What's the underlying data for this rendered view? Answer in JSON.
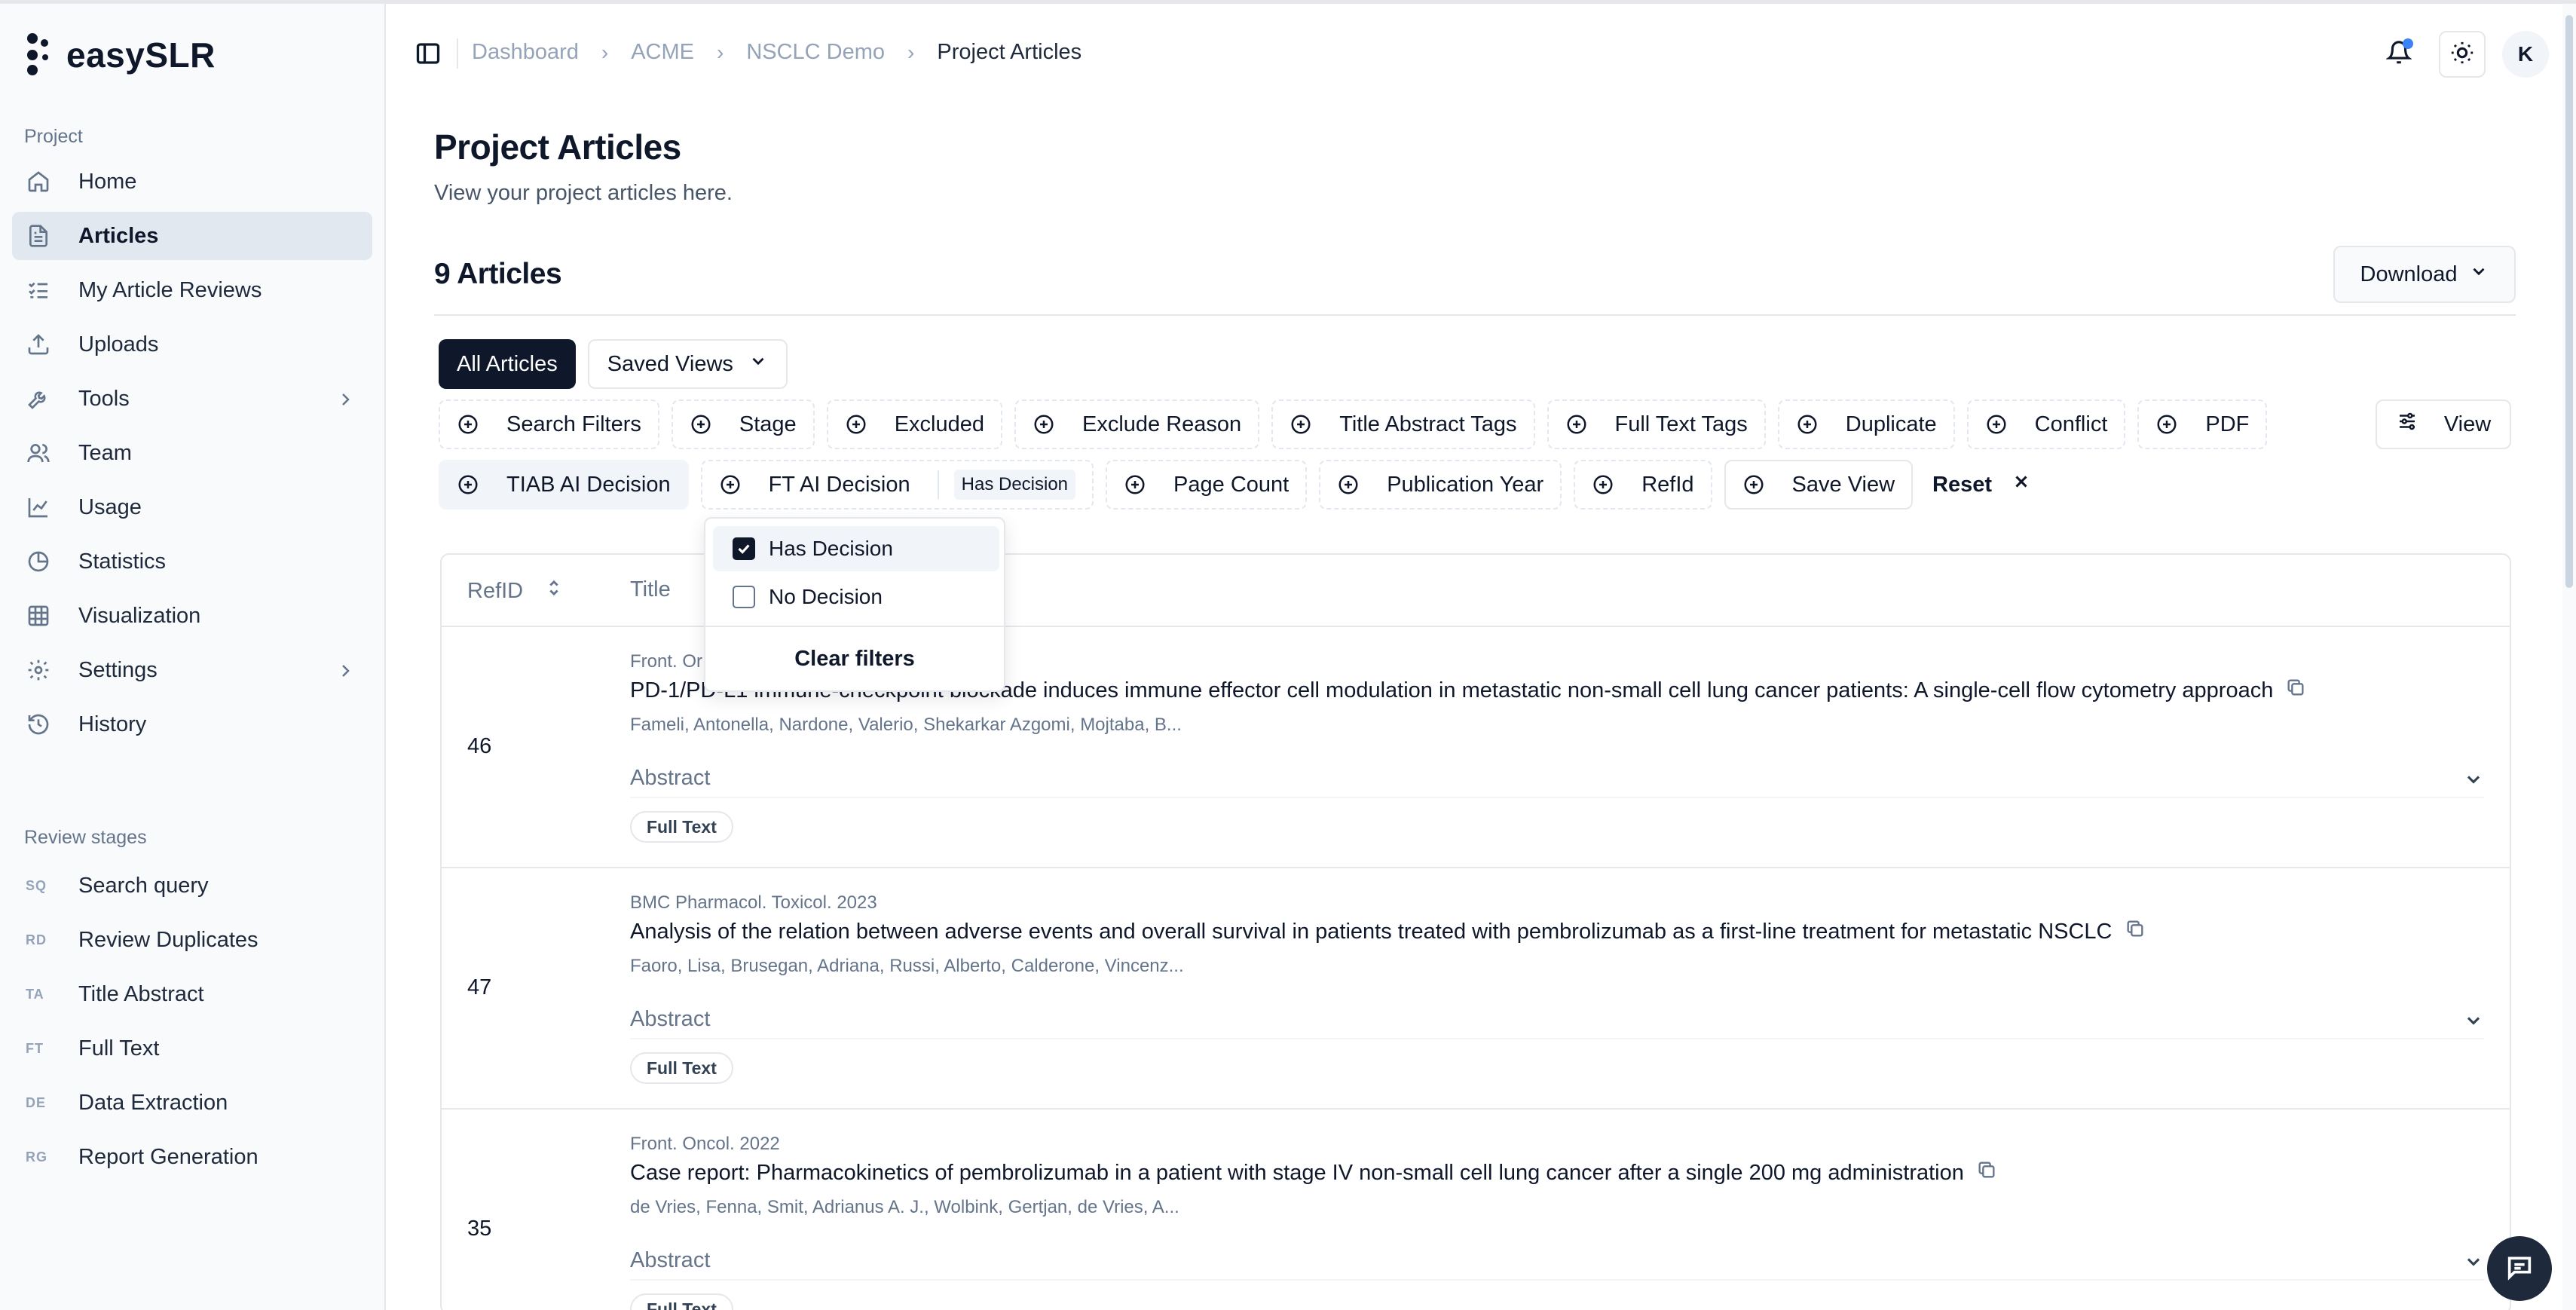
{
  "app": {
    "name": "easySLR"
  },
  "sidebar": {
    "project_label": "Project",
    "items": [
      {
        "label": "Home",
        "icon": "home-icon"
      },
      {
        "label": "Articles",
        "icon": "file-text-icon",
        "active": true
      },
      {
        "label": "My Article Reviews",
        "icon": "list-checks-icon"
      },
      {
        "label": "Uploads",
        "icon": "upload-icon"
      },
      {
        "label": "Tools",
        "icon": "wrench-icon",
        "has_submenu": true
      },
      {
        "label": "Team",
        "icon": "users-icon"
      },
      {
        "label": "Usage",
        "icon": "line-chart-icon"
      },
      {
        "label": "Statistics",
        "icon": "pie-chart-icon"
      },
      {
        "label": "Visualization",
        "icon": "grid-icon"
      },
      {
        "label": "Settings",
        "icon": "gear-icon",
        "has_submenu": true
      },
      {
        "label": "History",
        "icon": "history-icon"
      }
    ],
    "stages_label": "Review stages",
    "stages": [
      {
        "abbr": "SQ",
        "label": "Search query"
      },
      {
        "abbr": "RD",
        "label": "Review Duplicates"
      },
      {
        "abbr": "TA",
        "label": "Title Abstract"
      },
      {
        "abbr": "FT",
        "label": "Full Text"
      },
      {
        "abbr": "DE",
        "label": "Data Extraction"
      },
      {
        "abbr": "RG",
        "label": "Report Generation"
      }
    ]
  },
  "header": {
    "breadcrumbs": [
      "Dashboard",
      "ACME",
      "NSCLC Demo",
      "Project Articles"
    ],
    "avatar_initial": "K"
  },
  "main": {
    "title": "Project Articles",
    "subtitle": "View your project articles here.",
    "count_title": "9 Articles",
    "download_label": "Download",
    "tabs": {
      "all": "All Articles",
      "saved": "Saved Views"
    },
    "filters_row1": [
      "Search Filters",
      "Stage",
      "Excluded",
      "Exclude Reason",
      "Title Abstract Tags",
      "Full Text Tags",
      "Duplicate",
      "Conflict",
      "PDF"
    ],
    "filters_row2": {
      "tiab": "TIAB AI Decision",
      "ft": "FT AI Decision",
      "ft_tag": "Has Decision",
      "page_count": "Page Count",
      "pub_year": "Publication Year",
      "refid": "RefId",
      "save_view": "Save View",
      "reset": "Reset"
    },
    "view_label": "View"
  },
  "dropdown": {
    "options": [
      {
        "label": "Has Decision",
        "checked": true
      },
      {
        "label": "No Decision",
        "checked": false
      }
    ],
    "clear_label": "Clear filters"
  },
  "table": {
    "headers": {
      "refid": "RefID",
      "title": "Title"
    },
    "rows": [
      {
        "refid": "46",
        "journal": "Front. Or",
        "title": "PD-1/PD-L1 immune-checkpoint blockade induces immune effector cell modulation in metastatic non-small cell lung cancer patients: A single-cell flow cytometry approach",
        "authors": "Fameli, Antonella, Nardone, Valerio, Shekarkar Azgomi, Mojtaba, B...",
        "abstract_label": "Abstract",
        "badge": "Full Text"
      },
      {
        "refid": "47",
        "journal": "BMC Pharmacol. Toxicol. 2023",
        "title": "Analysis of the relation between adverse events and overall survival in patients treated with pembrolizumab as a first-line treatment for metastatic NSCLC",
        "authors": "Faoro, Lisa, Brusegan, Adriana, Russi, Alberto, Calderone, Vincenz...",
        "abstract_label": "Abstract",
        "badge": "Full Text"
      },
      {
        "refid": "35",
        "journal": "Front. Oncol. 2022",
        "title": "Case report: Pharmacokinetics of pembrolizumab in a patient with stage IV non-small cell lung cancer after a single 200 mg administration",
        "authors": "de Vries, Fenna, Smit, Adrianus A. J., Wolbink, Gertjan, de Vries, A...",
        "abstract_label": "Abstract",
        "badge": "Full Text"
      }
    ]
  }
}
